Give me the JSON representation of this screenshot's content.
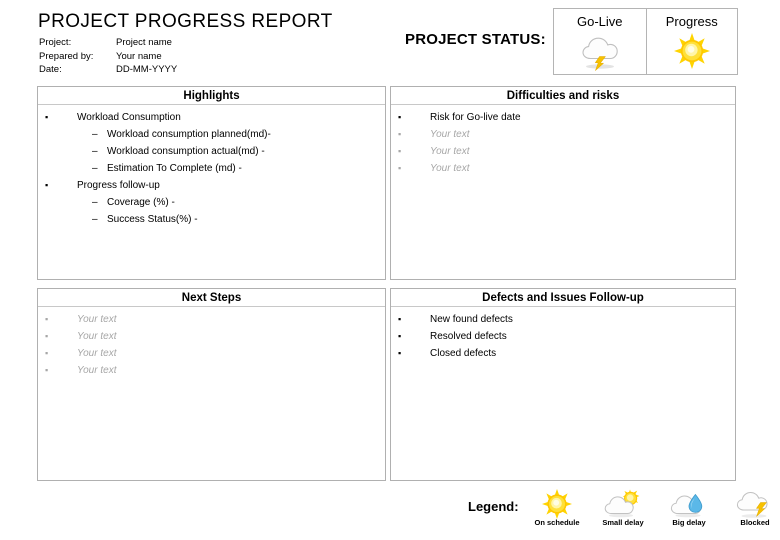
{
  "header": {
    "title": "PROJECT PROGRESS REPORT",
    "meta": [
      {
        "label": "Project:",
        "value": "Project name"
      },
      {
        "label": "Prepared by:",
        "value": "Your name"
      },
      {
        "label": "Date:",
        "value": "DD-MM-YYYY"
      }
    ],
    "status_title": "PROJECT STATUS:"
  },
  "status_table": {
    "cells": [
      {
        "label": "Go-Live",
        "icon": "thundercloud-icon",
        "status": "Blocked"
      },
      {
        "label": "Progress",
        "icon": "sun-icon",
        "status": "On schedule"
      }
    ]
  },
  "panels": {
    "highlights": {
      "title": "Highlights",
      "items": [
        {
          "text": "Workload Consumption",
          "placeholder": false,
          "subitems": [
            "Workload consumption planned(md)-",
            "Workload consumption actual(md) -",
            "Estimation To Complete (md) -"
          ]
        },
        {
          "text": "Progress follow-up",
          "placeholder": false,
          "subitems": [
            "Coverage (%) -",
            "Success Status(%) -"
          ]
        }
      ]
    },
    "difficulties": {
      "title": "Difficulties and risks",
      "items": [
        {
          "text": "Risk for Go-live date",
          "placeholder": false
        },
        {
          "text": "Your text",
          "placeholder": true
        },
        {
          "text": "Your text",
          "placeholder": true
        },
        {
          "text": "Your text",
          "placeholder": true
        }
      ]
    },
    "next_steps": {
      "title": "Next Steps",
      "items": [
        {
          "text": "Your text",
          "placeholder": true
        },
        {
          "text": "Your text",
          "placeholder": true
        },
        {
          "text": "Your text",
          "placeholder": true
        },
        {
          "text": "Your text",
          "placeholder": true
        }
      ]
    },
    "defects": {
      "title": "Defects and Issues Follow-up",
      "items": [
        {
          "text": "New found defects",
          "placeholder": false
        },
        {
          "text": "Resolved defects",
          "placeholder": false
        },
        {
          "text": "Closed defects",
          "placeholder": false
        }
      ]
    }
  },
  "legend": {
    "label": "Legend:",
    "items": [
      {
        "text": "On schedule",
        "icon": "sun-icon"
      },
      {
        "text": "Small delay",
        "icon": "sun-behind-cloud-icon"
      },
      {
        "text": "Big delay",
        "icon": "cloud-raindrop-icon"
      },
      {
        "text": "Blocked",
        "icon": "thundercloud-icon"
      }
    ]
  },
  "colors": {
    "sun_yellow": "#FFD400",
    "sun_core": "#FFF6A0",
    "cloud_white": "#FCFCFC",
    "cloud_outline": "#BFBFBF",
    "raindrop_blue": "#4FB3E8",
    "bolt_orange": "#F5B500",
    "placeholder_grey": "#A6A6A6",
    "panel_border": "#B0B0B0"
  }
}
